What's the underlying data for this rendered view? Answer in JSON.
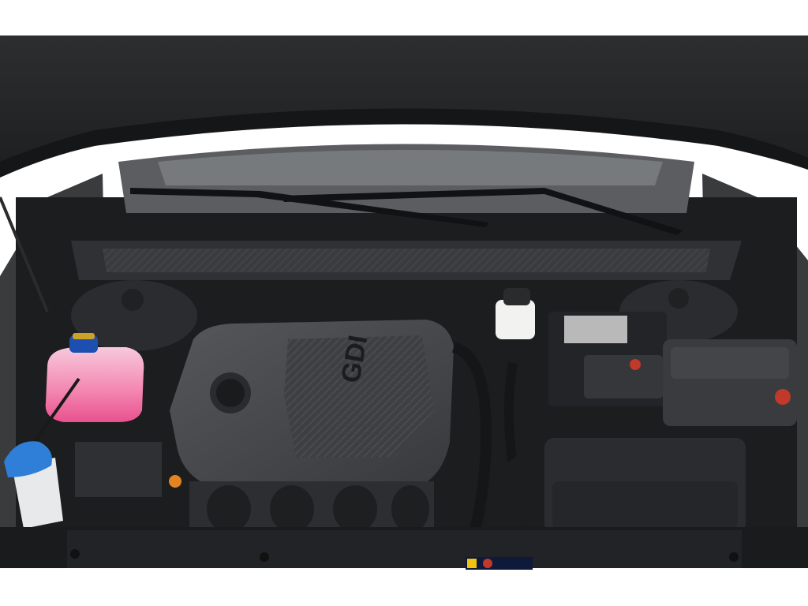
{
  "photo": {
    "subject": "engine-bay",
    "colors": {
      "background": "#ffffff",
      "hood": "#2a2b2d",
      "engine_cover": "#4a4b4e",
      "engine_cover_dark": "#3a3b3e",
      "coolant_pink": "#f06ca0",
      "washer_cap_blue": "#2f7fd8",
      "coolant_cap_blue": "#1d4fb0",
      "brake_reservoir": "#f2f2f0",
      "battery_red": "#c0392b"
    },
    "engine_cover_text": "GDI",
    "battery_label": "",
    "warning_sticker": "⚠ ⛔ ▣"
  }
}
